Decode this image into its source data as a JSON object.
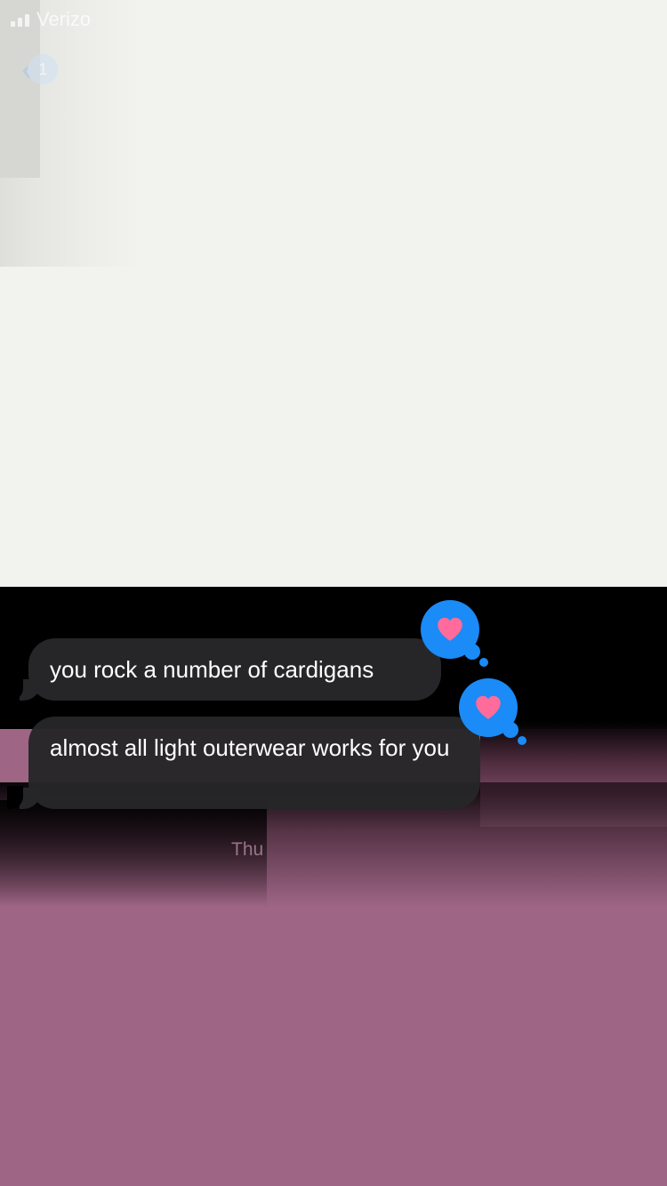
{
  "status_bar": {
    "carrier": "Verizo"
  },
  "nav": {
    "badge": "1"
  },
  "messages": [
    {
      "text": "you rock a number of cardigans",
      "reaction": "heart"
    },
    {
      "text": "almost all light outerwear works for you",
      "reaction": "heart"
    }
  ],
  "date_separator": "Thu",
  "colors": {
    "bubble": "#262628",
    "reaction": "#1a8bf7",
    "heart": "#ff6b9a",
    "overlay": "#9e6585"
  }
}
